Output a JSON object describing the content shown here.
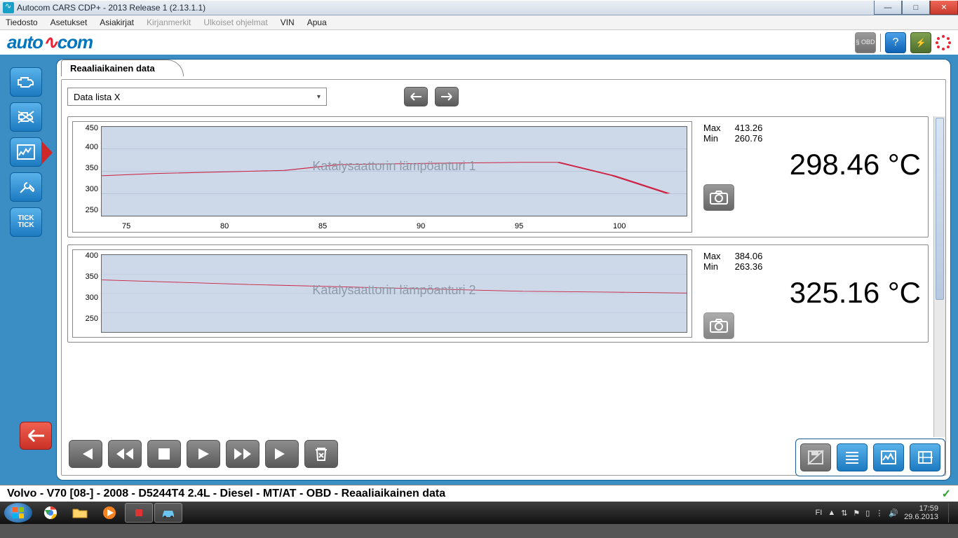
{
  "window": {
    "title": "Autocom CARS CDP+ - 2013 Release 1 (2.13.1.1)"
  },
  "menu": {
    "items": [
      "Tiedosto",
      "Asetukset",
      "Asiakirjat",
      "Kirjanmerkit",
      "Ulkoiset ohjelmat",
      "VIN",
      "Apua"
    ],
    "disabled": [
      3,
      4
    ]
  },
  "brand": {
    "part1": "auto",
    "pulse": "∿",
    "part2": "com"
  },
  "toolbar_right": {
    "obd": "§\nOBD",
    "help": "?",
    "battery": "⚡"
  },
  "left_tools": {
    "engine": "⎋",
    "no": "✕",
    "graph": "∿",
    "tools": "✖",
    "tick": "TICK\nTICK"
  },
  "tab": {
    "title": "Reaaliaikainen data"
  },
  "combo": {
    "value": "Data lista X"
  },
  "nav": {
    "prev": "↔",
    "next": "→"
  },
  "chart_data": [
    {
      "type": "line",
      "title": "Katalysaattorin lämpöanturi 1",
      "x": [
        72,
        75,
        80,
        82,
        85,
        90,
        95,
        97,
        100,
        103
      ],
      "y": [
        340,
        345,
        350,
        352,
        365,
        368,
        370,
        370,
        340,
        300
      ],
      "x_ticks": [
        "75",
        "80",
        "85",
        "90",
        "95",
        "100"
      ],
      "y_ticks": [
        "450",
        "400",
        "350",
        "300",
        "250"
      ],
      "ylim": [
        250,
        450
      ],
      "xlim": [
        72,
        104
      ],
      "readout": {
        "max": "413.26",
        "min": "260.76",
        "value": "298.46",
        "unit": "°C"
      }
    },
    {
      "type": "line",
      "title": "Katalysaattorin lämpöanturi 2",
      "x": [
        72,
        76,
        80,
        85,
        90,
        95,
        100,
        104
      ],
      "y": [
        365,
        360,
        355,
        350,
        345,
        340,
        338,
        336
      ],
      "x_ticks": [
        "75",
        "80",
        "85",
        "90",
        "95",
        "100"
      ],
      "y_ticks": [
        "400",
        "350",
        "300",
        "250"
      ],
      "ylim": [
        250,
        420
      ],
      "xlim": [
        72,
        104
      ],
      "readout": {
        "max": "384.06",
        "min": "263.36",
        "value": "325.16",
        "unit": "°C"
      }
    }
  ],
  "readout_labels": {
    "max": "Max",
    "min": "Min"
  },
  "player": {
    "first": "|◀",
    "rew": "◀◀",
    "stop": "■",
    "play": "▶",
    "ff": "▶▶",
    "last": "▶|",
    "trash": "✖"
  },
  "br_tools": {
    "save": "💾",
    "list": "≣",
    "graph": "∿",
    "full": "⛶"
  },
  "status": {
    "text": "Volvo - V70 [08-] - 2008 - D5244T4 2.4L - Diesel - MT/AT - OBD - Reaaliaikainen data",
    "ok": "✓"
  },
  "taskbar": {
    "lang": "FI",
    "time": "17:59",
    "date": "29.6.2013"
  }
}
